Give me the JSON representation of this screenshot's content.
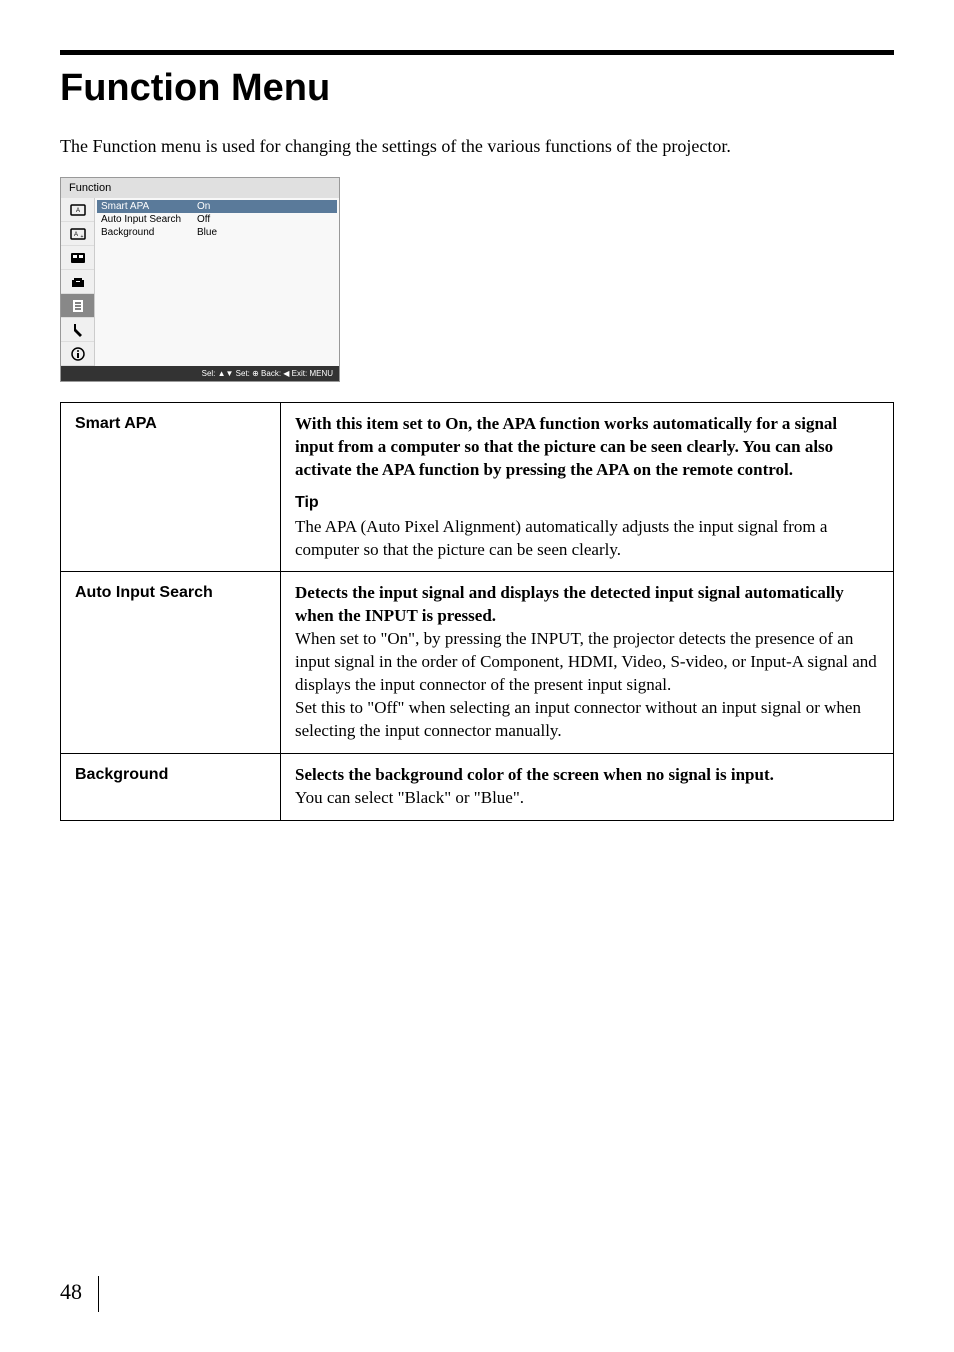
{
  "page": {
    "title": "Function Menu",
    "intro": "The Function menu is used for changing the settings of the various functions of the projector.",
    "page_number": "48"
  },
  "menu_screenshot": {
    "header": "Function",
    "rows": [
      {
        "label": "Smart APA",
        "value": "On",
        "selected": true
      },
      {
        "label": "Auto Input Search",
        "value": "Off",
        "selected": false
      },
      {
        "label": "Background",
        "value": "Blue",
        "selected": false
      }
    ],
    "footer": "Sel: ▲▼   Set: ⊕   Back: ◀   Exit: MENU"
  },
  "settings": [
    {
      "name": "Smart APA",
      "bold_desc": "With this item set to On, the APA function works automatically for a signal input from a computer so that the picture can be seen clearly. You can also activate the APA function by pressing the APA on the remote control.",
      "tip_heading": "Tip",
      "tip_body": "The APA (Auto Pixel Alignment) automatically adjusts the input signal from a computer so that the picture can be seen clearly."
    },
    {
      "name": "Auto Input Search",
      "bold_desc": "Detects the input signal and displays the detected input signal automatically when the INPUT is pressed.",
      "plain_desc": "When set to \"On\", by pressing the INPUT, the projector detects the presence of an input signal in the order of Component, HDMI, Video, S-video, or Input-A signal and displays the input connector of the present input signal.\nSet this to \"Off\" when selecting an input connector without an input signal or when selecting the input connector manually."
    },
    {
      "name": "Background",
      "bold_desc": "Selects the background color of the screen when no signal is input.",
      "plain_desc": "You can select \"Black\" or \"Blue\"."
    }
  ]
}
